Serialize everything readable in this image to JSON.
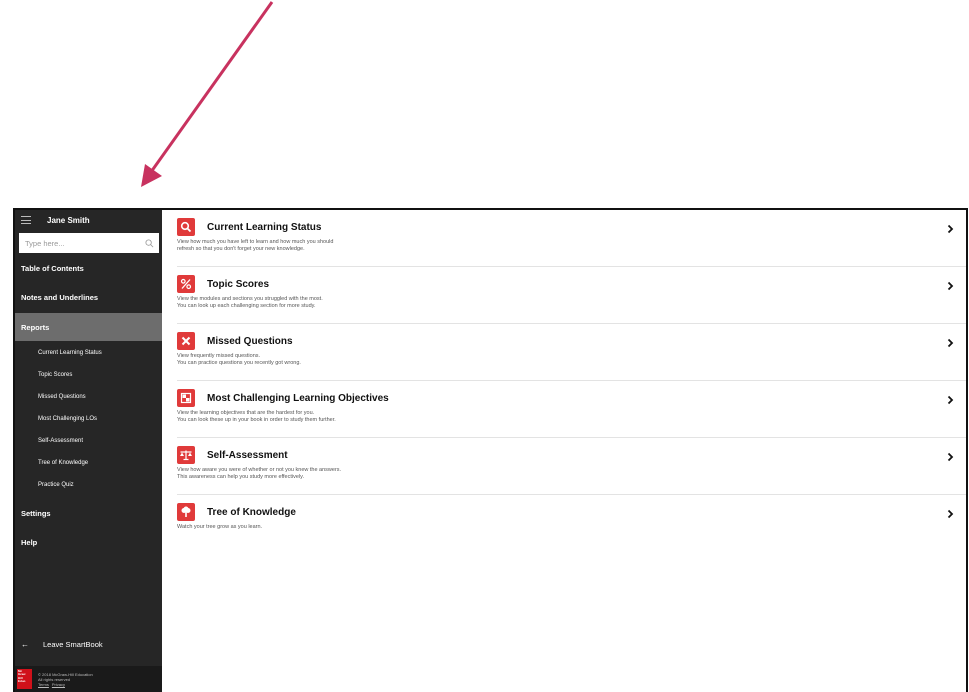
{
  "colors": {
    "arrow": "#c8325f",
    "accent": "#e03a3a",
    "sidebar_bg": "#262626",
    "active_bg": "#6d6d6d"
  },
  "sidebar": {
    "menu_icon": "hamburger-icon",
    "user_name": "Jane Smith",
    "search": {
      "placeholder": "Type here...",
      "icon": "search-icon"
    },
    "nav": {
      "toc": "Table of Contents",
      "notes": "Notes and Underlines",
      "reports": "Reports",
      "settings": "Settings",
      "help": "Help"
    },
    "report_items": [
      "Current Learning Status",
      "Topic Scores",
      "Missed Questions",
      "Most Challenging LOs",
      "Self-Assessment",
      "Tree of Knowledge",
      "Practice Quiz"
    ],
    "leave": {
      "arrow": "←",
      "label": "Leave SmartBook"
    },
    "footer": {
      "logo": "Mc Graw Hill Education",
      "copyright": "© 2018 McGraw-Hill Education",
      "rights": "All rights reserved",
      "terms": "Terms",
      "privacy": "Privacy"
    }
  },
  "reports": [
    {
      "icon": "magnifier-icon",
      "title": "Current Learning Status",
      "desc1": "View how much you have left to learn and how much you should",
      "desc2": "refresh so that you don't forget your new knowledge."
    },
    {
      "icon": "percent-icon",
      "title": "Topic Scores",
      "desc1": "View the modules and sections you struggled with the most.",
      "desc2": "You can look up each challenging section for more study."
    },
    {
      "icon": "x-mark-icon",
      "title": "Missed Questions",
      "desc1": "View frequently missed questions.",
      "desc2": "You can practice questions you recently got wrong."
    },
    {
      "icon": "checker-icon",
      "title": "Most Challenging Learning Objectives",
      "desc1": "View the learning objectives that are the hardest for you.",
      "desc2": "You can look these up in your book in order to study them further."
    },
    {
      "icon": "scales-icon",
      "title": "Self-Assessment",
      "desc1": "View how aware you were of whether or not you knew the answers.",
      "desc2": "This awareness can help you study more effectively."
    },
    {
      "icon": "tree-icon",
      "title": "Tree of Knowledge",
      "desc1": "Watch your tree grow as you learn.",
      "desc2": ""
    }
  ]
}
